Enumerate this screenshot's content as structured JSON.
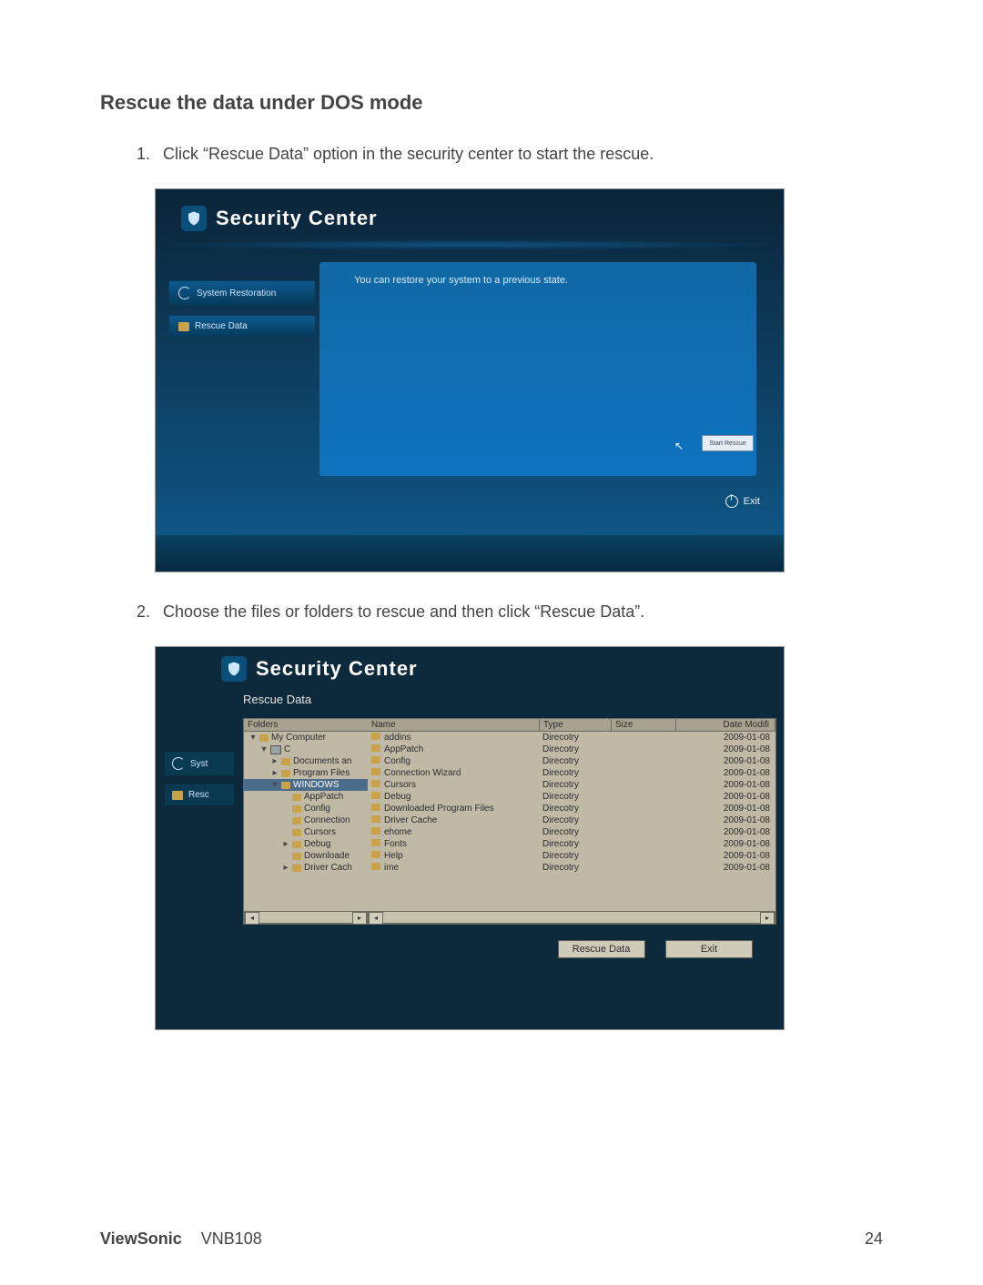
{
  "heading": "Rescue the data under DOS mode",
  "steps": {
    "s1": "Click “Rescue Data” option in the security center to start the rescue.",
    "s2": "Choose the files or folders to rescue and then click “Rescue Data”."
  },
  "screenshot1": {
    "title": "Security Center",
    "sidebar": {
      "system_restoration": "System Restoration",
      "rescue_data": "Rescue Data"
    },
    "panel_message": "You can restore your system to a previous state.",
    "start_rescue_button": "Start Rescue",
    "exit_label": "Exit"
  },
  "screenshot2": {
    "title": "Security Center",
    "tab_label": "Rescue Data",
    "sidebar": {
      "sys": "Syst",
      "resc": "Resc"
    },
    "tree": {
      "header": "Folders",
      "items": [
        {
          "indent": 0,
          "marker": "▾",
          "icon": "computer",
          "label": "My Computer"
        },
        {
          "indent": 1,
          "marker": "▾",
          "icon": "disk",
          "label": "C"
        },
        {
          "indent": 2,
          "marker": "▸",
          "icon": "folder",
          "label": "Documents an"
        },
        {
          "indent": 2,
          "marker": "▸",
          "icon": "folder",
          "label": "Program Files"
        },
        {
          "indent": 2,
          "marker": "▾",
          "icon": "folder",
          "label": "WINDOWS",
          "selected": true
        },
        {
          "indent": 3,
          "marker": "",
          "icon": "folder",
          "label": "AppPatch"
        },
        {
          "indent": 3,
          "marker": "",
          "icon": "folder",
          "label": "Config"
        },
        {
          "indent": 3,
          "marker": "",
          "icon": "folder",
          "label": "Connection"
        },
        {
          "indent": 3,
          "marker": "",
          "icon": "folder",
          "label": "Cursors"
        },
        {
          "indent": 3,
          "marker": "▸",
          "icon": "folder",
          "label": "Debug"
        },
        {
          "indent": 3,
          "marker": "",
          "icon": "folder",
          "label": "Downloade"
        },
        {
          "indent": 3,
          "marker": "▸",
          "icon": "folder",
          "label": "Driver Cach"
        }
      ]
    },
    "list": {
      "headers": {
        "name": "Name",
        "type": "Type",
        "size": "Size",
        "date": "Date Modifi"
      },
      "rows": [
        {
          "name": "addins",
          "type": "Direcotry",
          "size": "",
          "date": "2009-01-08"
        },
        {
          "name": "AppPatch",
          "type": "Direcotry",
          "size": "",
          "date": "2009-01-08"
        },
        {
          "name": "Config",
          "type": "Direcotry",
          "size": "",
          "date": "2009-01-08"
        },
        {
          "name": "Connection Wizard",
          "type": "Direcotry",
          "size": "",
          "date": "2009-01-08"
        },
        {
          "name": "Cursors",
          "type": "Direcotry",
          "size": "",
          "date": "2009-01-08"
        },
        {
          "name": "Debug",
          "type": "Direcotry",
          "size": "",
          "date": "2009-01-08"
        },
        {
          "name": "Downloaded Program Files",
          "type": "Direcotry",
          "size": "",
          "date": "2009-01-08"
        },
        {
          "name": "Driver Cache",
          "type": "Direcotry",
          "size": "",
          "date": "2009-01-08"
        },
        {
          "name": "ehome",
          "type": "Direcotry",
          "size": "",
          "date": "2009-01-08"
        },
        {
          "name": "Fonts",
          "type": "Direcotry",
          "size": "",
          "date": "2009-01-08"
        },
        {
          "name": "Help",
          "type": "Direcotry",
          "size": "",
          "date": "2009-01-08"
        },
        {
          "name": "ime",
          "type": "Direcotry",
          "size": "",
          "date": "2009-01-08"
        }
      ]
    },
    "buttons": {
      "rescue": "Rescue Data",
      "exit": "Exit"
    }
  },
  "footer": {
    "brand": "ViewSonic",
    "model": "VNB108",
    "page": "24"
  }
}
